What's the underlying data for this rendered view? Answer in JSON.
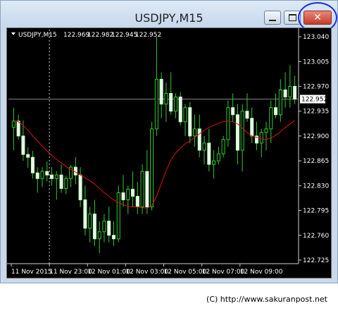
{
  "window": {
    "title": "USDJPY,M15"
  },
  "chart_info": {
    "symbol": "USDJPY,M15",
    "ohlc": [
      "122.969",
      "122.982",
      "122.945",
      "122.952"
    ],
    "current_price": "122.952"
  },
  "chart_data": {
    "type": "candlestick",
    "y_ticks": [
      "123.040",
      "123.005",
      "122.970",
      "122.935",
      "122.900",
      "122.865",
      "122.830",
      "122.795",
      "122.760",
      "122.725"
    ],
    "x_ticks": [
      "11 Nov 2015",
      "11 Nov 23:00",
      "12 Nov 01:00",
      "12 Nov 03:00",
      "12 Nov 05:00",
      "12 Nov 07:00",
      "12 Nov 09:00"
    ],
    "ylim": [
      122.72,
      123.05
    ],
    "current_price": 122.952,
    "candles": [
      [
        122.912,
        122.94,
        122.88,
        122.921
      ],
      [
        122.921,
        122.93,
        122.895,
        122.9
      ],
      [
        122.9,
        122.922,
        122.865,
        122.874
      ],
      [
        122.874,
        122.884,
        122.855,
        122.87
      ],
      [
        122.87,
        122.879,
        122.84,
        122.848
      ],
      [
        122.848,
        122.856,
        122.82,
        122.84
      ],
      [
        122.84,
        122.856,
        122.828,
        122.85
      ],
      [
        122.85,
        122.864,
        122.836,
        122.845
      ],
      [
        122.845,
        122.856,
        122.83,
        122.84
      ],
      [
        122.84,
        122.85,
        122.81,
        122.845
      ],
      [
        122.845,
        122.86,
        122.82,
        122.826
      ],
      [
        122.826,
        122.844,
        122.818,
        122.84
      ],
      [
        122.84,
        122.859,
        122.828,
        122.856
      ],
      [
        122.856,
        122.87,
        122.832,
        122.845
      ],
      [
        122.845,
        122.856,
        122.8,
        122.81
      ],
      [
        122.81,
        122.83,
        122.76,
        122.77
      ],
      [
        122.77,
        122.8,
        122.75,
        122.79
      ],
      [
        122.79,
        122.81,
        122.745,
        122.755
      ],
      [
        122.755,
        122.78,
        122.735,
        122.765
      ],
      [
        122.765,
        122.79,
        122.75,
        122.78
      ],
      [
        122.78,
        122.8,
        122.75,
        122.76
      ],
      [
        122.76,
        122.78,
        122.745,
        122.755
      ],
      [
        122.755,
        122.83,
        122.75,
        122.82
      ],
      [
        122.82,
        122.845,
        122.8,
        122.81
      ],
      [
        122.81,
        122.83,
        122.79,
        122.825
      ],
      [
        122.825,
        122.85,
        122.8,
        122.815
      ],
      [
        122.815,
        122.835,
        122.79,
        122.8
      ],
      [
        122.8,
        122.86,
        122.79,
        122.85
      ],
      [
        122.85,
        122.88,
        122.79,
        122.8
      ],
      [
        122.8,
        122.92,
        122.795,
        122.91
      ],
      [
        122.91,
        123.04,
        122.9,
        122.98
      ],
      [
        122.98,
        122.99,
        122.925,
        122.945
      ],
      [
        122.945,
        122.975,
        122.92,
        122.96
      ],
      [
        122.96,
        122.99,
        122.93,
        122.935
      ],
      [
        122.935,
        122.96,
        122.925,
        122.955
      ],
      [
        122.955,
        122.962,
        122.915,
        122.92
      ],
      [
        122.92,
        122.945,
        122.9,
        122.94
      ],
      [
        122.94,
        122.948,
        122.89,
        122.9
      ],
      [
        122.9,
        122.93,
        122.885,
        122.91
      ],
      [
        122.91,
        122.93,
        122.87,
        122.88
      ],
      [
        122.88,
        122.9,
        122.86,
        122.89
      ],
      [
        122.89,
        122.91,
        122.85,
        122.86
      ],
      [
        122.86,
        122.88,
        122.84,
        122.865
      ],
      [
        122.865,
        122.885,
        122.86,
        122.875
      ],
      [
        122.875,
        122.9,
        122.87,
        122.895
      ],
      [
        122.895,
        122.95,
        122.885,
        122.94
      ],
      [
        122.94,
        122.96,
        122.92,
        122.93
      ],
      [
        122.93,
        122.945,
        122.86,
        122.88
      ],
      [
        122.88,
        122.945,
        122.85,
        122.935
      ],
      [
        122.935,
        122.96,
        122.92,
        122.925
      ],
      [
        122.925,
        122.94,
        122.89,
        122.9
      ],
      [
        122.9,
        122.92,
        122.88,
        122.89
      ],
      [
        122.89,
        122.91,
        122.87,
        122.905
      ],
      [
        122.905,
        122.92,
        122.88,
        122.91
      ],
      [
        122.91,
        122.95,
        122.89,
        122.94
      ],
      [
        122.94,
        122.96,
        122.925,
        122.93
      ],
      [
        122.93,
        122.98,
        122.92,
        122.965
      ],
      [
        122.965,
        122.99,
        122.94,
        122.955
      ],
      [
        122.955,
        123.0,
        122.94,
        122.97
      ],
      [
        122.97,
        122.985,
        122.945,
        122.952
      ]
    ],
    "ma": [
      122.922,
      122.92,
      122.915,
      122.908,
      122.9,
      122.893,
      122.886,
      122.879,
      122.873,
      122.867,
      122.862,
      122.857,
      122.853,
      122.849,
      122.845,
      122.841,
      122.837,
      122.832,
      122.826,
      122.82,
      122.815,
      122.81,
      122.806,
      122.803,
      122.801,
      122.8,
      122.8,
      122.799,
      122.798,
      122.802,
      122.815,
      122.833,
      122.851,
      122.866,
      122.876,
      122.883,
      122.889,
      122.893,
      122.898,
      122.903,
      122.908,
      122.912,
      122.915,
      122.918,
      122.92,
      122.921,
      122.92,
      122.917,
      122.911,
      122.905,
      122.9,
      122.898,
      122.896,
      122.895,
      122.897,
      122.901,
      122.906,
      122.912,
      122.917,
      122.922
    ]
  },
  "footer": {
    "credit": "(C) http://www.sakuranpost.net"
  }
}
